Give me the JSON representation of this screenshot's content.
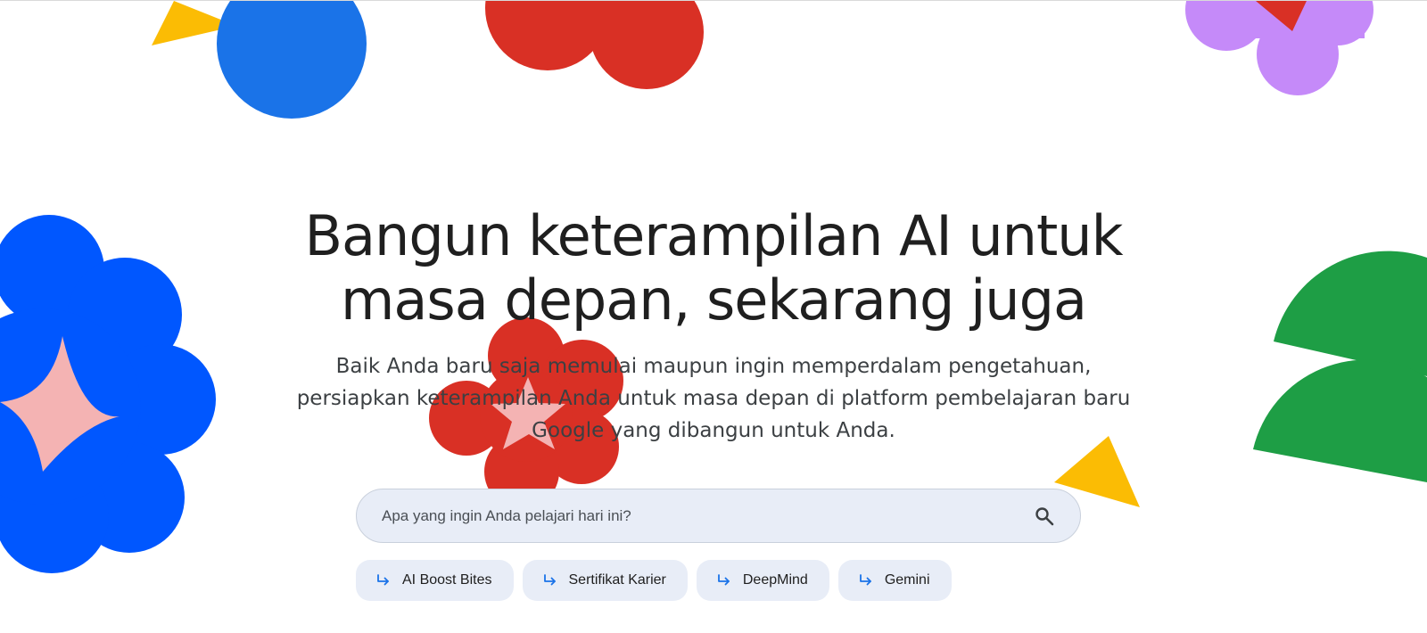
{
  "hero": {
    "title_line1": "Bangun keterampilan AI untuk",
    "title_line2": "masa depan, sekarang juga",
    "subtitle_line1": "Baik Anda baru saja memulai maupun ingin memperdalam pengetahuan,",
    "subtitle_line2": "persiapkan keterampilan Anda untuk masa depan di platform pembelajaran baru",
    "subtitle_line3": "Google yang dibangun untuk Anda."
  },
  "search": {
    "placeholder": "Apa yang ingin Anda pelajari hari ini?",
    "value": "",
    "icon": "search-icon"
  },
  "chips": [
    {
      "label": "AI Boost Bites",
      "icon": "arrow-return-icon"
    },
    {
      "label": "Sertifikat Karier",
      "icon": "arrow-return-icon"
    },
    {
      "label": "DeepMind",
      "icon": "arrow-return-icon"
    },
    {
      "label": "Gemini",
      "icon": "arrow-return-icon"
    }
  ],
  "colors": {
    "yellow": "#fbbc04",
    "blue": "#1a73e8",
    "bright_blue": "#0057ff",
    "red": "#d93025",
    "purple": "#c58af9",
    "green": "#1e9e45",
    "pink": "#f4b3b3",
    "search_background": "#e8edf7",
    "text_dark": "#1f1f1f",
    "text_body": "#3c4043",
    "chip_icon": "#1a73e8"
  }
}
